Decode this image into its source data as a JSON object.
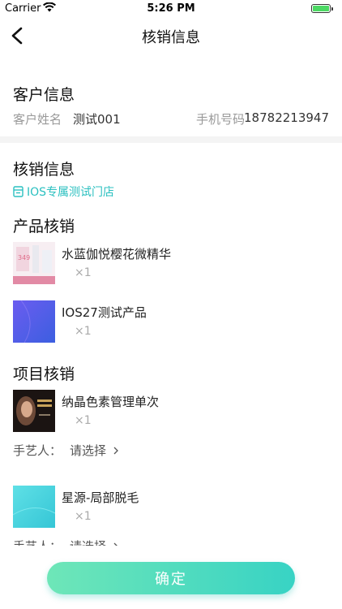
{
  "status_bar": {
    "carrier": "Carrier",
    "time": "5:26 PM",
    "battery_level": 1.0,
    "battery_color": "#4cd964"
  },
  "nav": {
    "title": "核销信息",
    "back_icon": "chevron-left-icon"
  },
  "customer": {
    "section_title": "客户信息",
    "name_label": "客户姓名",
    "name_value": "测试001",
    "phone_label": "手机号码",
    "phone_value": "18782213947"
  },
  "writeoff": {
    "section_title": "核销信息",
    "store_icon": "store-icon",
    "store_name": "IOS专属测试门店"
  },
  "products": {
    "section_title": "产品核销",
    "items": [
      {
        "name": "水蓝伽悦樱花微精华",
        "qty": "×1"
      },
      {
        "name": "IOS27测试产品",
        "qty": "×1"
      }
    ]
  },
  "projects": {
    "section_title": "项目核销",
    "items": [
      {
        "name": "纳晶色素管理单次",
        "qty": "×1",
        "artisan_label": "手艺人：",
        "artisan_select": "请选择"
      },
      {
        "name": "星源-局部脱毛",
        "qty": "×1",
        "artisan_label": "手艺人：",
        "artisan_select": "请选择"
      }
    ]
  },
  "footer": {
    "confirm_label": "确定"
  },
  "colors": {
    "accent": "#2bc0c0",
    "button_gradient_start": "#6ee6b8",
    "button_gradient_end": "#38d3c4"
  }
}
